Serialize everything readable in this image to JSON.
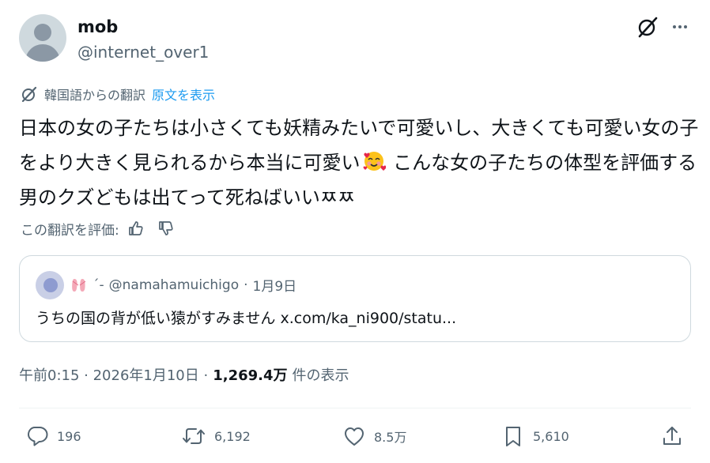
{
  "author": {
    "name": "mob",
    "handle": "@internet_over1"
  },
  "translation": {
    "label": "韓国語からの翻訳",
    "show_original": "原文を表示",
    "rate_label": "この翻訳を評価:"
  },
  "tweet": {
    "text_part1": "日本の女の子たちは小さくても妖精みたいで可愛いし、大きくても可愛い女の子をより大きく見られるから本当に可愛い",
    "text_part2": " こんな女の子たちの体型を評価する男のクズどもは出てって死ねばいいㅉㅉ"
  },
  "quoted": {
    "display_name": "´-",
    "handle": "@namahamuichigo",
    "separator": "·",
    "date": "1月9日",
    "text": "うちの国の背が低い猿がすみません x.com/ka_ni900/statu..."
  },
  "meta": {
    "time": "午前0:15 · 2026年1月10日 ·",
    "views": "1,269.4万",
    "views_label": "件の表示"
  },
  "actions": {
    "replies": "196",
    "reposts": "6,192",
    "likes": "8.5万",
    "bookmarks": "5,610"
  },
  "colors": {
    "text": "#0f1419",
    "secondary": "#536471",
    "link": "#1d9bf0",
    "border": "#cfd9de"
  },
  "icons": [
    "grok-icon",
    "more-icon",
    "translate-icon",
    "thumbs-up-icon",
    "thumbs-down-icon",
    "reply-icon",
    "repost-icon",
    "like-icon",
    "bookmark-icon",
    "share-icon",
    "ballet-shoes-emoji",
    "smiling-hearts-emoji"
  ]
}
